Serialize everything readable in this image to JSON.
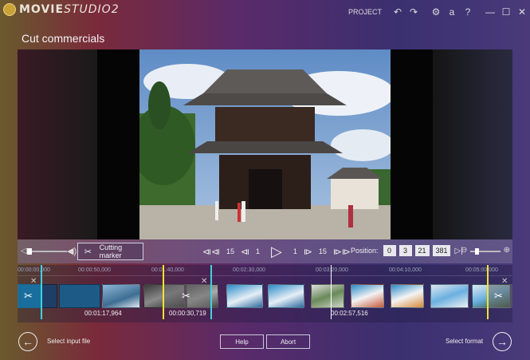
{
  "app": {
    "logo_text_bold": "MOVIE",
    "logo_text_italic": "STUDIO",
    "logo_version": "2",
    "project_label": "PROJECT"
  },
  "titlebar_icons": [
    "undo-icon",
    "redo-icon",
    "settings-icon",
    "font-icon",
    "help-icon",
    "minimize-icon",
    "maximize-icon",
    "close-icon"
  ],
  "titlebar_glyphs": {
    "undo": "↶",
    "redo": "↷",
    "settings": "⚙",
    "font": "a",
    "help": "?",
    "minimize": "—",
    "maximize": "☐",
    "close": "✕"
  },
  "page": {
    "title": "Cut commercials"
  },
  "controls": {
    "cutting_marker_label": "Cutting marker",
    "skip_back_large": "15",
    "skip_back_small": "1",
    "skip_fwd_small": "1",
    "skip_fwd_large": "15",
    "position_label": "Position:",
    "position": [
      "0",
      "3",
      "21",
      "381"
    ]
  },
  "timeline": {
    "ruler_ticks": [
      "00:00:00,000",
      "00:00:50,000",
      "00:01:40,000",
      "00:02:30,000",
      "00:03:20,000",
      "00:04:10,000",
      "00:05:00,000"
    ],
    "timecodes": [
      "00:01:17,964",
      "00:00:30,719",
      "00:02:57,516"
    ]
  },
  "footer": {
    "back_label": "Select input file",
    "help_label": "Help",
    "abort_label": "Abort",
    "next_label": "Select format"
  },
  "colors": {
    "cut_zone": "#1a7fb0",
    "marker_cyan": "#3fd0e0",
    "marker_yellow": "#f2e32a"
  }
}
